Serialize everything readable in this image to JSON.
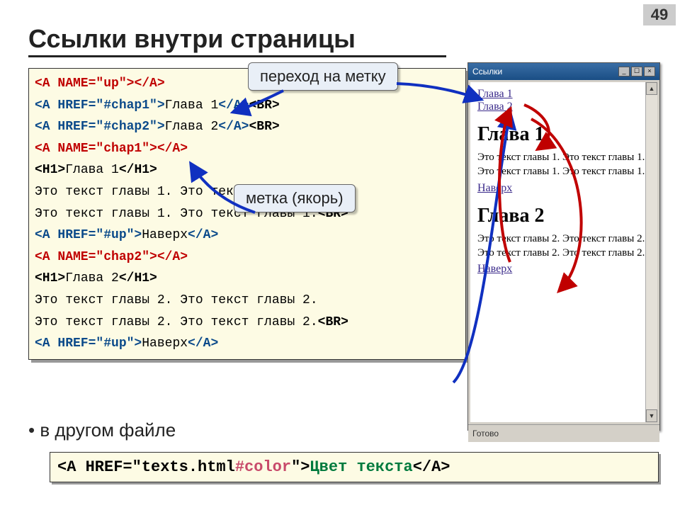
{
  "slide_number": "49",
  "title": "Ссылки внутри страницы",
  "callouts": {
    "jump": "переход на метку",
    "anchor": "метка (якорь)"
  },
  "code": {
    "l01a": "<A NAME=\"up\">",
    "l01b": "</A>",
    "l02a": "<A HREF=\"#chap1\">",
    "l02b": "Глава 1",
    "l02c": "</A>",
    "l02d": "<BR>",
    "l03a": "<A HREF=\"#chap2\">",
    "l03b": "Глава 2",
    "l03c": "</A>",
    "l03d": "<BR>",
    "l04a": "<A NAME=\"chap1\">",
    "l04b": "</A>",
    "l05a": "<H1>",
    "l05b": "Глава 1",
    "l05c": "</H1>",
    "l06": "Это текст главы 1. Это текст главы 1.",
    "l07a": "Это текст главы 1. Это текст главы 1.",
    "l07b": "<BR>",
    "l08a": "<A HREF=\"#up\">",
    "l08b": "Наверх",
    "l08c": "</A>",
    "l09a": "<A NAME=\"chap2\">",
    "l09b": "</A>",
    "l10a": "<H1>",
    "l10b": "Глава 2",
    "l10c": "</H1>",
    "l11": "Это текст главы 2. Это текст главы 2.",
    "l12a": "Это текст главы 2. Это текст главы 2.",
    "l12b": "<BR>",
    "l13a": "<A HREF=\"#up\">",
    "l13b": "Наверх",
    "l13c": "</A>"
  },
  "bullet": "в другом файле",
  "code2": {
    "open": "<A HREF=\"texts.html",
    "hash": "#color",
    "close": "\">",
    "text": "Цвет текста",
    "end": "</A>"
  },
  "browser": {
    "title": "Ссылки",
    "win": {
      "min": "_",
      "max": "☐",
      "close": "×"
    },
    "scroll": {
      "up": "▲",
      "down": "▼"
    },
    "link1": "Глава 1",
    "link2": "Глава 2",
    "h1a": "Глава 1",
    "p1": "Это текст главы 1. Это текст главы 1. Это текст главы 1. Это текст главы 1.",
    "back1": "Наверх",
    "h1b": "Глава 2",
    "p2": "Это текст главы 2. Это текст главы 2. Это текст главы 2. Это текст главы 2.",
    "back2": "Наверх",
    "status": "Готово"
  }
}
